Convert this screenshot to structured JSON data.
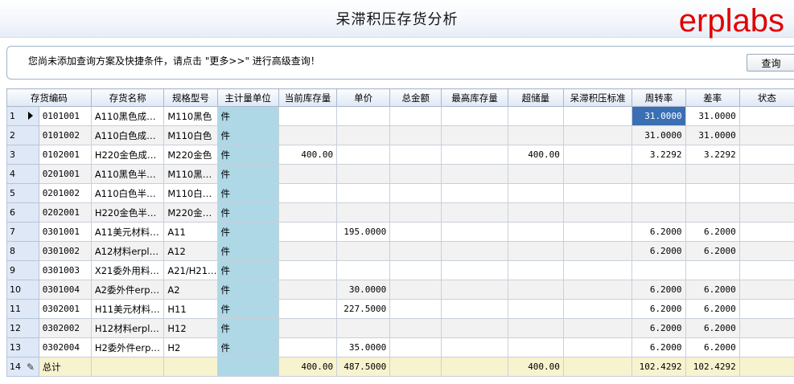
{
  "window": {
    "title": "呆滞积压存货分析",
    "brand": "erplabs"
  },
  "hint": {
    "text": "您尚未添加查询方案及快捷条件，请点击 \"更多>>\" 进行高级查询！",
    "query_button": "查询"
  },
  "grid": {
    "columns": [
      "存货编码",
      "存货名称",
      "规格型号",
      "主计量单位",
      "当前库存量",
      "单价",
      "总金额",
      "最高库存量",
      "超储量",
      "呆滞积压标准",
      "周转率",
      "差率",
      "状态"
    ],
    "rows": [
      {
        "no": "1",
        "code": "0101001",
        "name": "A110黑色成…",
        "spec": "M110黑色",
        "unit": "件",
        "stock": "",
        "price": "",
        "amount": "",
        "max": "",
        "over": "",
        "standard": "",
        "turnover": "31.0000",
        "diff": "31.0000",
        "status": ""
      },
      {
        "no": "2",
        "code": "0101002",
        "name": "A110白色成…",
        "spec": "M110白色",
        "unit": "件",
        "stock": "",
        "price": "",
        "amount": "",
        "max": "",
        "over": "",
        "standard": "",
        "turnover": "31.0000",
        "diff": "31.0000",
        "status": ""
      },
      {
        "no": "3",
        "code": "0102001",
        "name": "H220金色成…",
        "spec": "M220金色",
        "unit": "件",
        "stock": "400.00",
        "price": "",
        "amount": "",
        "max": "",
        "over": "400.00",
        "standard": "",
        "turnover": "3.2292",
        "diff": "3.2292",
        "status": ""
      },
      {
        "no": "4",
        "code": "0201001",
        "name": "A110黑色半…",
        "spec": "M110黑…",
        "unit": "件",
        "stock": "",
        "price": "",
        "amount": "",
        "max": "",
        "over": "",
        "standard": "",
        "turnover": "",
        "diff": "",
        "status": ""
      },
      {
        "no": "5",
        "code": "0201002",
        "name": "A110白色半…",
        "spec": "M110白…",
        "unit": "件",
        "stock": "",
        "price": "",
        "amount": "",
        "max": "",
        "over": "",
        "standard": "",
        "turnover": "",
        "diff": "",
        "status": ""
      },
      {
        "no": "6",
        "code": "0202001",
        "name": "H220金色半…",
        "spec": "M220金…",
        "unit": "件",
        "stock": "",
        "price": "",
        "amount": "",
        "max": "",
        "over": "",
        "standard": "",
        "turnover": "",
        "diff": "",
        "status": ""
      },
      {
        "no": "7",
        "code": "0301001",
        "name": "A11美元材料…",
        "spec": "A11",
        "unit": "件",
        "stock": "",
        "price": "195.0000",
        "amount": "",
        "max": "",
        "over": "",
        "standard": "",
        "turnover": "6.2000",
        "diff": "6.2000",
        "status": ""
      },
      {
        "no": "8",
        "code": "0301002",
        "name": "A12材料erpl…",
        "spec": "A12",
        "unit": "件",
        "stock": "",
        "price": "",
        "amount": "",
        "max": "",
        "over": "",
        "standard": "",
        "turnover": "6.2000",
        "diff": "6.2000",
        "status": ""
      },
      {
        "no": "9",
        "code": "0301003",
        "name": "X21委外用料…",
        "spec": "A21/H21…",
        "unit": "件",
        "stock": "",
        "price": "",
        "amount": "",
        "max": "",
        "over": "",
        "standard": "",
        "turnover": "",
        "diff": "",
        "status": ""
      },
      {
        "no": "10",
        "code": "0301004",
        "name": "A2委外件erp…",
        "spec": "A2",
        "unit": "件",
        "stock": "",
        "price": "30.0000",
        "amount": "",
        "max": "",
        "over": "",
        "standard": "",
        "turnover": "6.2000",
        "diff": "6.2000",
        "status": ""
      },
      {
        "no": "11",
        "code": "0302001",
        "name": "H11美元材料…",
        "spec": "H11",
        "unit": "件",
        "stock": "",
        "price": "227.5000",
        "amount": "",
        "max": "",
        "over": "",
        "standard": "",
        "turnover": "6.2000",
        "diff": "6.2000",
        "status": ""
      },
      {
        "no": "12",
        "code": "0302002",
        "name": "H12材料erpl…",
        "spec": "H12",
        "unit": "件",
        "stock": "",
        "price": "",
        "amount": "",
        "max": "",
        "over": "",
        "standard": "",
        "turnover": "6.2000",
        "diff": "6.2000",
        "status": ""
      },
      {
        "no": "13",
        "code": "0302004",
        "name": "H2委外件erp…",
        "spec": "H2",
        "unit": "件",
        "stock": "",
        "price": "35.0000",
        "amount": "",
        "max": "",
        "over": "",
        "standard": "",
        "turnover": "6.2000",
        "diff": "6.2000",
        "status": ""
      }
    ],
    "total": {
      "no": "14",
      "label": "总计",
      "stock": "400.00",
      "price": "487.5000",
      "over": "400.00",
      "turnover": "102.4292",
      "diff": "102.4292"
    }
  }
}
